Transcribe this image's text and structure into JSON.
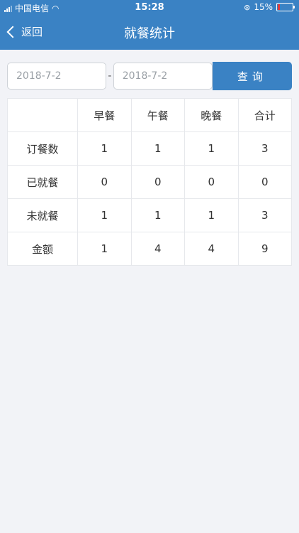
{
  "status_bar": {
    "carrier": "中国电信",
    "time": "15:28",
    "battery": "15%",
    "battery_level": 0.15,
    "icons": [
      "signal-icon",
      "wifi-icon",
      "orientation-lock-icon",
      "battery-icon"
    ]
  },
  "nav": {
    "back_label": "返回",
    "title": "就餐统计"
  },
  "search": {
    "start_date": "2018-7-2",
    "separator": "-",
    "end_date": "2018-7-2",
    "query_label": "查询"
  },
  "table": {
    "headers": [
      "",
      "早餐",
      "午餐",
      "晚餐",
      "合计"
    ],
    "rows": [
      {
        "label": "订餐数",
        "values": [
          "1",
          "1",
          "1",
          "3"
        ]
      },
      {
        "label": "已就餐",
        "values": [
          "0",
          "0",
          "0",
          "0"
        ]
      },
      {
        "label": "未就餐",
        "values": [
          "1",
          "1",
          "1",
          "3"
        ]
      },
      {
        "label": "金额",
        "values": [
          "1",
          "4",
          "4",
          "9"
        ]
      }
    ]
  },
  "colors": {
    "accent": "#3a82c4",
    "background": "#f2f3f7",
    "battery_low": "#e23a3a"
  }
}
